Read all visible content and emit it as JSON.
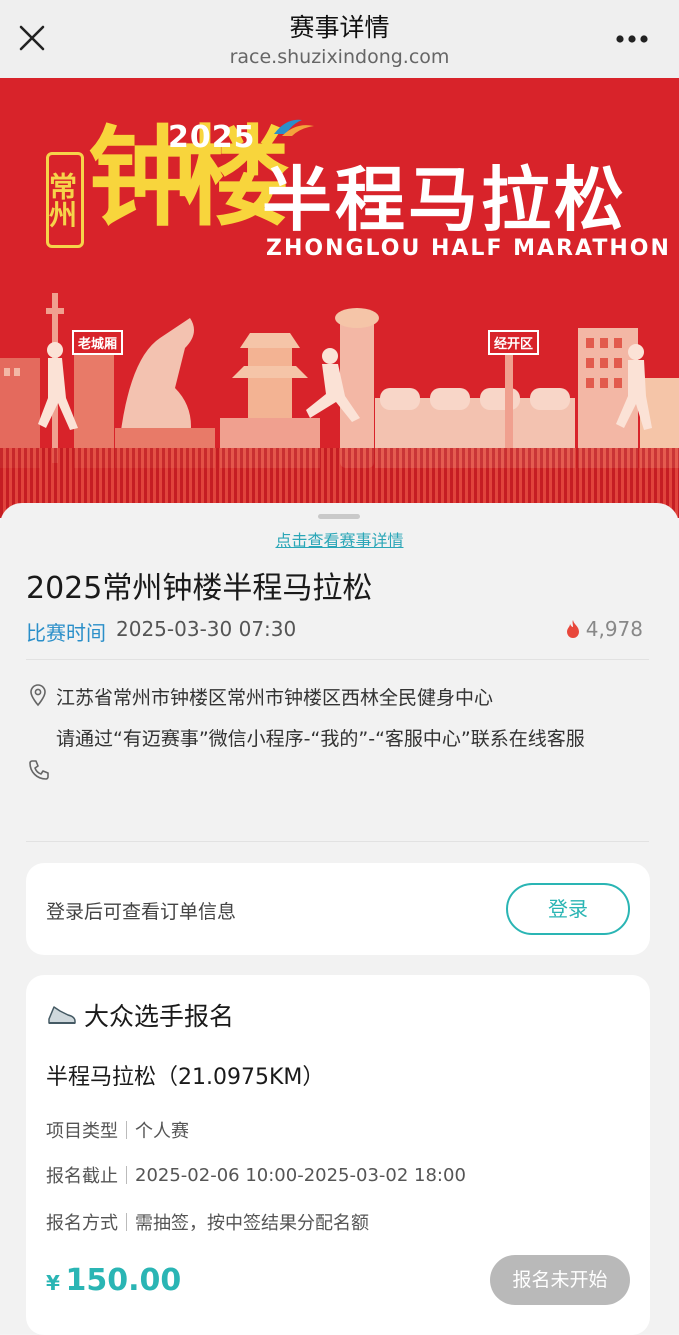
{
  "nav": {
    "title": "赛事详情",
    "url": "race.shuzixindong.com",
    "close_icon": "close-icon",
    "more_icon": "more-icon"
  },
  "banner": {
    "year": "2025",
    "city": "常州",
    "name_big": "钟楼",
    "name_rest": "半程马拉松",
    "name_en": "ZHONGLOU HALF MARATHON",
    "tag_left": "老城厢",
    "tag_right": "经开区"
  },
  "sheet": {
    "detail_link": "点击查看赛事详情",
    "title": "2025常州钟楼半程马拉松",
    "time_label": "比赛时间",
    "time_value": "2025-03-30 07:30",
    "views": "4,978",
    "location": "江苏省常州市钟楼区常州市钟楼区西林全民健身中心",
    "contact": "请通过“有迈赛事”微信小程序-“我的”-“客服中心”联系在线客服"
  },
  "login_card": {
    "text": "登录后可查看订单信息",
    "button": "登录"
  },
  "registration": {
    "title": "大众选手报名",
    "race_name": "半程马拉松（21.0975KM）",
    "rows": [
      {
        "key": "项目类型",
        "value": "个人赛"
      },
      {
        "key": "报名截止",
        "value": "2025-02-06 10:00-2025-03-02 18:00"
      },
      {
        "key": "报名方式",
        "value": "需抽签，按中签结果分配名额"
      }
    ],
    "currency": "¥",
    "price": "150.00",
    "status_button": "报名未开始"
  },
  "colors": {
    "accent": "#2ab5b4",
    "time_label": "#2a8fc9",
    "banner_red": "#d8232a",
    "banner_gold": "#f8d53c",
    "disabled": "#b9b9b9"
  }
}
